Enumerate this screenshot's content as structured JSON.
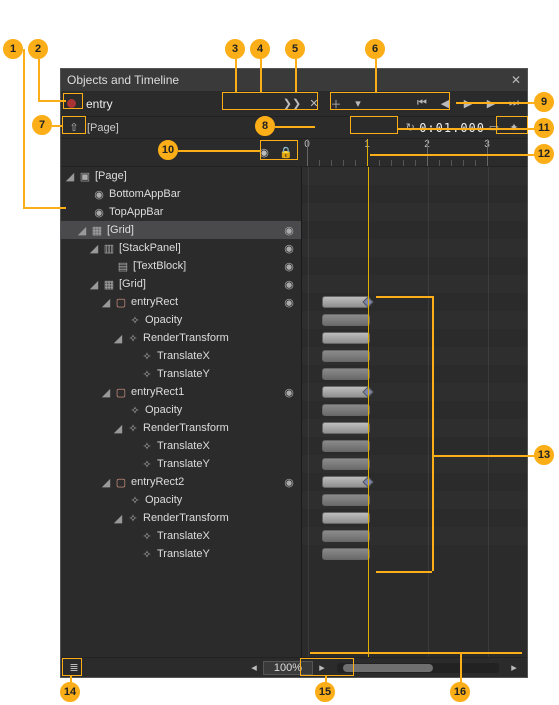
{
  "panel": {
    "title": "Objects and Timeline"
  },
  "storyboard": {
    "name": "entry"
  },
  "selectionScope": {
    "label": "[Page]"
  },
  "time": {
    "current": "0:01.000"
  },
  "zoom": {
    "value": "100%"
  },
  "ruler": {
    "t0": "0",
    "t1": "1",
    "t2": "2",
    "t3": "3"
  },
  "tree": {
    "page": "[Page]",
    "bottomAppBar": "BottomAppBar",
    "topAppBar": "TopAppBar",
    "grid": "[Grid]",
    "stackPanel": "[StackPanel]",
    "textBlock": "[TextBlock]",
    "grid2": "[Grid]",
    "entryRect": "entryRect",
    "opacity": "Opacity",
    "renderTransform": "RenderTransform",
    "translateX": "TranslateX",
    "translateY": "TranslateY",
    "entryRect1": "entryRect1",
    "entryRect2": "entryRect2"
  },
  "callouts": {
    "n1": "1",
    "n2": "2",
    "n3": "3",
    "n4": "4",
    "n5": "5",
    "n6": "6",
    "n7": "7",
    "n8": "8",
    "n9": "9",
    "n10": "10",
    "n11": "11",
    "n12": "12",
    "n13": "13",
    "n14": "14",
    "n15": "15",
    "n16": "16"
  },
  "chart_data": {
    "type": "timeline",
    "time_unit": "seconds",
    "playhead": 1.0,
    "visible_range": [
      0,
      3
    ],
    "tracks": [
      {
        "name": "entryRect",
        "start": 0.3,
        "end": 1.0,
        "properties": [
          "Opacity",
          "RenderTransform.TranslateX",
          "RenderTransform.TranslateY"
        ]
      },
      {
        "name": "entryRect1",
        "start": 0.3,
        "end": 1.0,
        "properties": [
          "Opacity",
          "RenderTransform.TranslateX",
          "RenderTransform.TranslateY"
        ]
      },
      {
        "name": "entryRect2",
        "start": 0.3,
        "end": 1.0,
        "properties": [
          "Opacity",
          "RenderTransform.TranslateX",
          "RenderTransform.TranslateY"
        ]
      }
    ]
  }
}
